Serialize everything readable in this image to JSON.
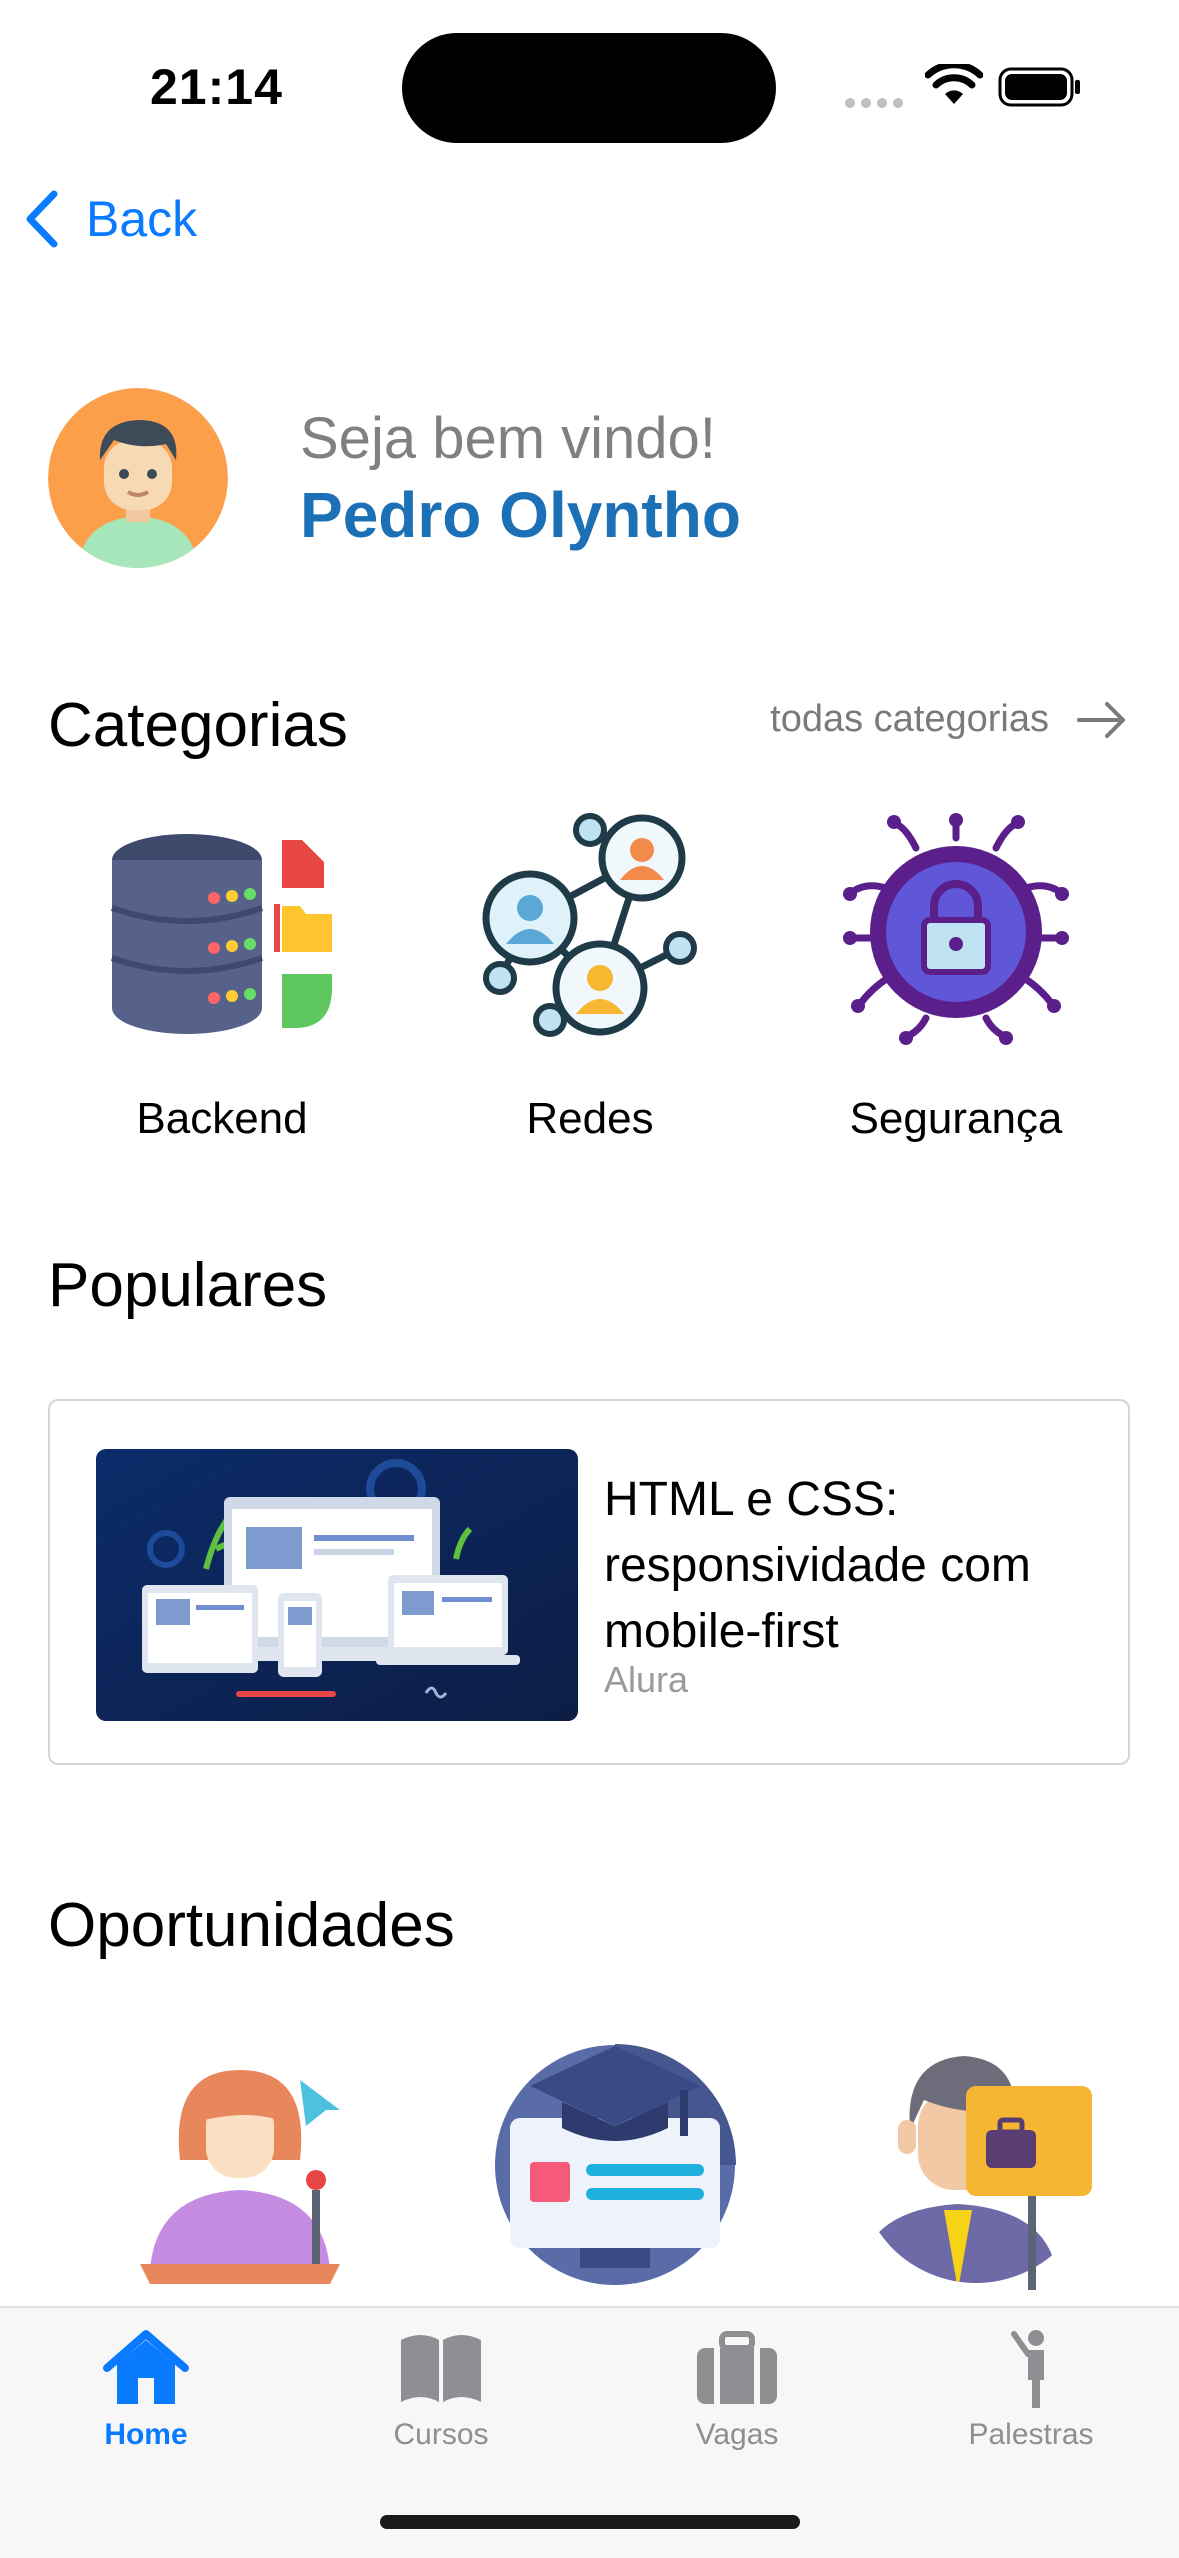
{
  "status_bar": {
    "time": "21:14"
  },
  "nav": {
    "back_label": "Back"
  },
  "profile": {
    "greeting": "Seja bem vindo!",
    "name": "Pedro Olyntho"
  },
  "categories": {
    "title": "Categorias",
    "see_all": "todas categorias",
    "items": [
      {
        "label": "Backend",
        "icon": "server-database-icon"
      },
      {
        "label": "Redes",
        "icon": "network-users-icon"
      },
      {
        "label": "Segurança",
        "icon": "security-lock-icon"
      }
    ]
  },
  "popular": {
    "title": "Populares",
    "course": {
      "title": "HTML e CSS: responsividade com mobile-first",
      "source": "Alura"
    }
  },
  "opportunities": {
    "title": "Oportunidades",
    "items": [
      {
        "icon": "speaker-woman-icon"
      },
      {
        "icon": "graduation-screen-icon"
      },
      {
        "icon": "job-seeker-icon"
      }
    ]
  },
  "tabbar": {
    "tabs": [
      {
        "label": "Home",
        "active": true
      },
      {
        "label": "Cursos",
        "active": false
      },
      {
        "label": "Vagas",
        "active": false
      },
      {
        "label": "Palestras",
        "active": false
      }
    ]
  },
  "colors": {
    "accent": "#0a7aff",
    "name": "#1c70b5",
    "muted": "#8e8e93"
  }
}
